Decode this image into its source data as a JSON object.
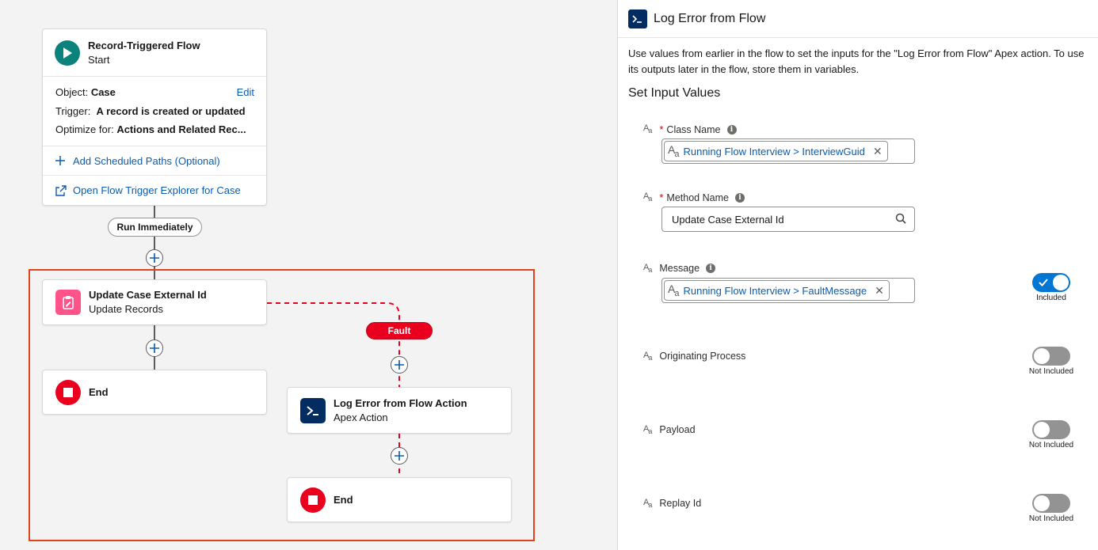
{
  "canvas": {
    "start": {
      "title": "Record-Triggered Flow",
      "subtitle": "Start",
      "object_label": "Object:",
      "object_value": "Case",
      "edit_label": "Edit",
      "trigger_label": "Trigger:",
      "trigger_value": "A record is created or updated",
      "optimize_label": "Optimize for:",
      "optimize_value": "Actions and Related Rec...",
      "add_paths_label": "Add Scheduled Paths (Optional)",
      "explorer_label": "Open Flow Trigger Explorer for Case"
    },
    "run_immediately": "Run Immediately",
    "update_node": {
      "title": "Update Case External Id",
      "subtitle": "Update Records"
    },
    "end_label_1": "End",
    "fault_label": "Fault",
    "log_node": {
      "title": "Log Error from Flow Action",
      "subtitle": "Apex Action"
    },
    "end_label_2": "End"
  },
  "panel": {
    "title": "Log Error from Flow",
    "description": "Use values from earlier in the flow to set the inputs for the \"Log Error from Flow\" Apex action. To use its outputs later in the flow, store them in variables.",
    "section_title": "Set Input Values",
    "fields": {
      "class_name": {
        "label": "Class Name",
        "token": "Running Flow Interview > InterviewGuid"
      },
      "method_name": {
        "label": "Method Name",
        "value": "Update Case External Id"
      },
      "message": {
        "label": "Message",
        "token": "Running Flow Interview > FaultMessage",
        "toggle_label": "Included"
      },
      "originating_process": {
        "label": "Originating Process",
        "toggle_label": "Not Included"
      },
      "payload": {
        "label": "Payload",
        "toggle_label": "Not Included"
      },
      "replay_id": {
        "label": "Replay Id",
        "toggle_label": "Not Included"
      }
    }
  },
  "colors": {
    "link": "#0b5cab",
    "start_icon": "#0b827c",
    "update_icon": "#ff538a",
    "end_icon": "#ea001e",
    "apex_icon": "#032d60",
    "fault": "#ea001e",
    "highlight": "#e4411f",
    "toggle_on": "#0176d3",
    "toggle_off": "#939393"
  }
}
